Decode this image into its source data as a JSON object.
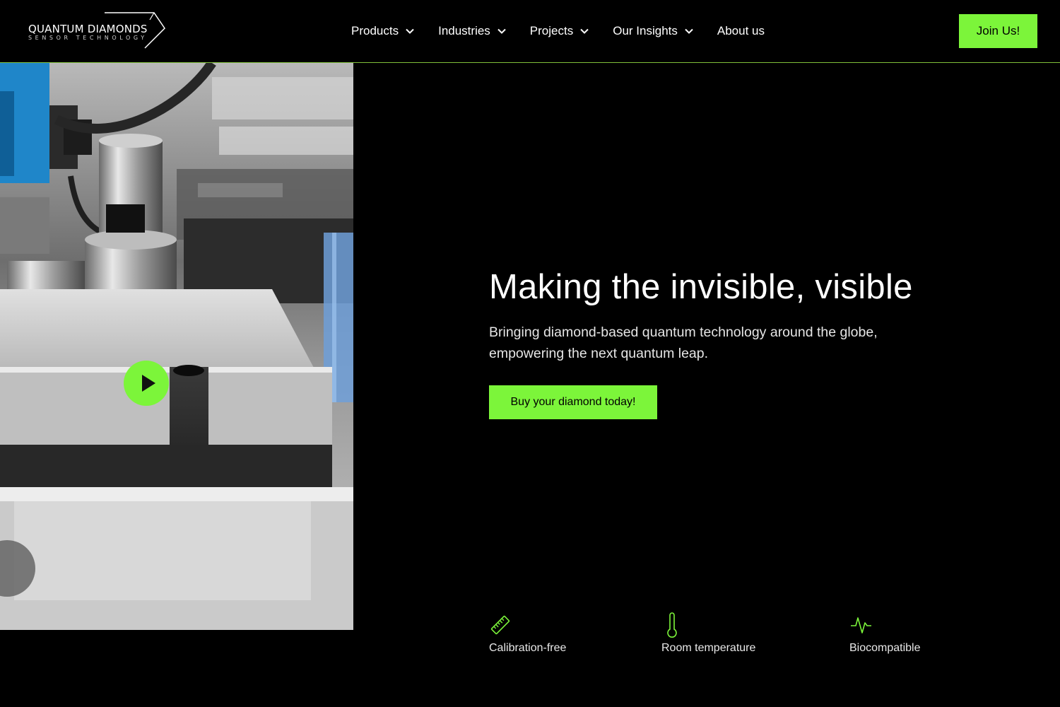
{
  "brand": {
    "name": "QUANTUM DIAMONDS",
    "tagline": "SENSOR TECHNOLOGY",
    "accent": "#7cf53a"
  },
  "nav": {
    "items": [
      {
        "label": "Products",
        "has_dropdown": true
      },
      {
        "label": "Industries",
        "has_dropdown": true
      },
      {
        "label": "Projects",
        "has_dropdown": true
      },
      {
        "label": "Our Insights",
        "has_dropdown": true
      },
      {
        "label": "About us",
        "has_dropdown": false
      }
    ],
    "join_label": "Join Us!"
  },
  "video": {
    "play_icon": "play-icon"
  },
  "hero": {
    "title": "Making the invisible, visible",
    "subtitle": "Bringing diamond-based quantum technology around the globe, empowering the next quantum leap.",
    "cta_label": "Buy your diamond today!"
  },
  "features": [
    {
      "label": "Calibration-free",
      "icon": "ruler-icon"
    },
    {
      "label": "Room temperature",
      "icon": "thermometer-icon"
    },
    {
      "label": "Biocompatible",
      "icon": "pulse-icon"
    }
  ]
}
